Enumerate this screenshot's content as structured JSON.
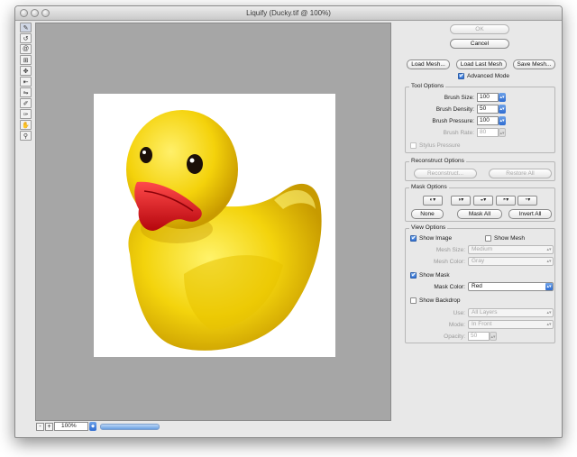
{
  "window": {
    "title": "Liquify (Ducky.tif @ 100%)"
  },
  "toolbar": {
    "tools": [
      "forward-warp",
      "reconstruct",
      "twirl",
      "pucker",
      "bloat",
      "push-left",
      "mirror",
      "freeze-mask",
      "thaw-mask",
      "hand",
      "zoom"
    ]
  },
  "status": {
    "zoom_value": "100%",
    "minus_label": "-",
    "plus_label": "+"
  },
  "panel": {
    "ok_label": "OK",
    "cancel_label": "Cancel",
    "load_mesh_label": "Load Mesh...",
    "load_last_mesh_label": "Load Last Mesh",
    "save_mesh_label": "Save Mesh...",
    "advanced_mode_label": "Advanced Mode",
    "tool_options": {
      "title": "Tool Options",
      "brush_size_label": "Brush Size:",
      "brush_size_value": "100",
      "brush_density_label": "Brush Density:",
      "brush_density_value": "50",
      "brush_pressure_label": "Brush Pressure:",
      "brush_pressure_value": "100",
      "brush_rate_label": "Brush Rate:",
      "brush_rate_value": "80",
      "stylus_pressure_label": "Stylus Pressure"
    },
    "reconstruct_options": {
      "title": "Reconstruct Options",
      "reconstruct_label": "Reconstruct...",
      "restore_all_label": "Restore All"
    },
    "mask_options": {
      "title": "Mask Options",
      "none_label": "None",
      "mask_all_label": "Mask All",
      "invert_all_label": "Invert All"
    },
    "view_options": {
      "title": "View Options",
      "show_image_label": "Show Image",
      "show_mesh_label": "Show Mesh",
      "mesh_size_label": "Mesh Size:",
      "mesh_size_value": "Medium",
      "mesh_color_label": "Mesh Color:",
      "mesh_color_value": "Gray",
      "show_mask_label": "Show Mask",
      "mask_color_label": "Mask Color:",
      "mask_color_value": "Red",
      "show_backdrop_label": "Show Backdrop",
      "use_label": "Use:",
      "use_value": "All Layers",
      "mode_label": "Mode:",
      "mode_value": "In Front",
      "opacity_label": "Opacity:",
      "opacity_value": "50"
    }
  },
  "colors": {
    "accent": "#2d6bd1",
    "canvas_bg": "#a6a6a6",
    "duck": "#f2d20c",
    "beak": "#d4141a"
  }
}
